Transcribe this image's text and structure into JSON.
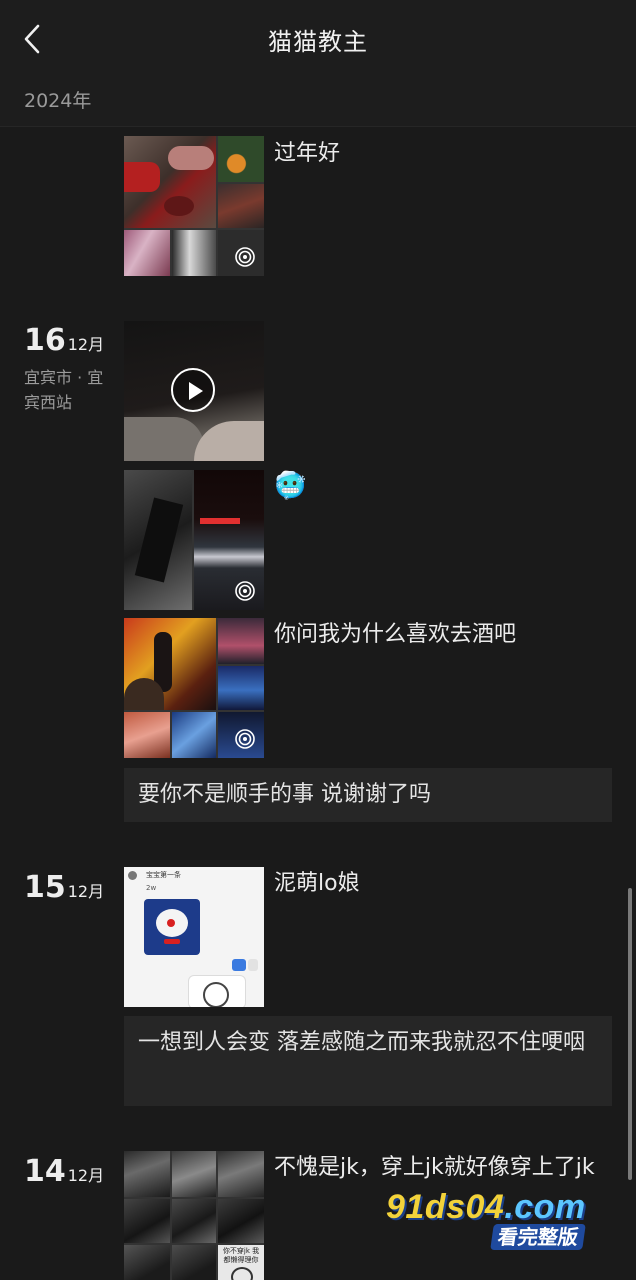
{
  "header": {
    "title": "猫猫教主"
  },
  "year_label": "2024年",
  "posts": [
    {
      "text": "过年好"
    },
    {
      "day": "16",
      "month": "12月",
      "location": "宜宾市 · 宜宾西站"
    },
    {
      "text": "🥶"
    },
    {
      "text": "你问我为什么喜欢去酒吧"
    },
    {
      "text": "要你不是顺手的事 说谢谢了吗"
    },
    {
      "day": "15",
      "month": "12月",
      "text": "泥萌lo娘"
    },
    {
      "text": "一想到人会变 落差感随之而来我就忍不住哽咽"
    },
    {
      "day": "14",
      "month": "12月",
      "text": "不愧是jk，穿上jk就好像穿上了jk"
    }
  ],
  "screenshot_thumb": {
    "name": "宝宝第一条",
    "count": "2w",
    "caption": "你不穿jk 我都懒得理你"
  },
  "watermark": {
    "main": "91ds04",
    "domain": ".com",
    "sub": "看完整版"
  },
  "colors": {
    "background": "#1a1a1a",
    "card": "#262626",
    "text": "#ececec",
    "muted": "#9a9a9a"
  }
}
